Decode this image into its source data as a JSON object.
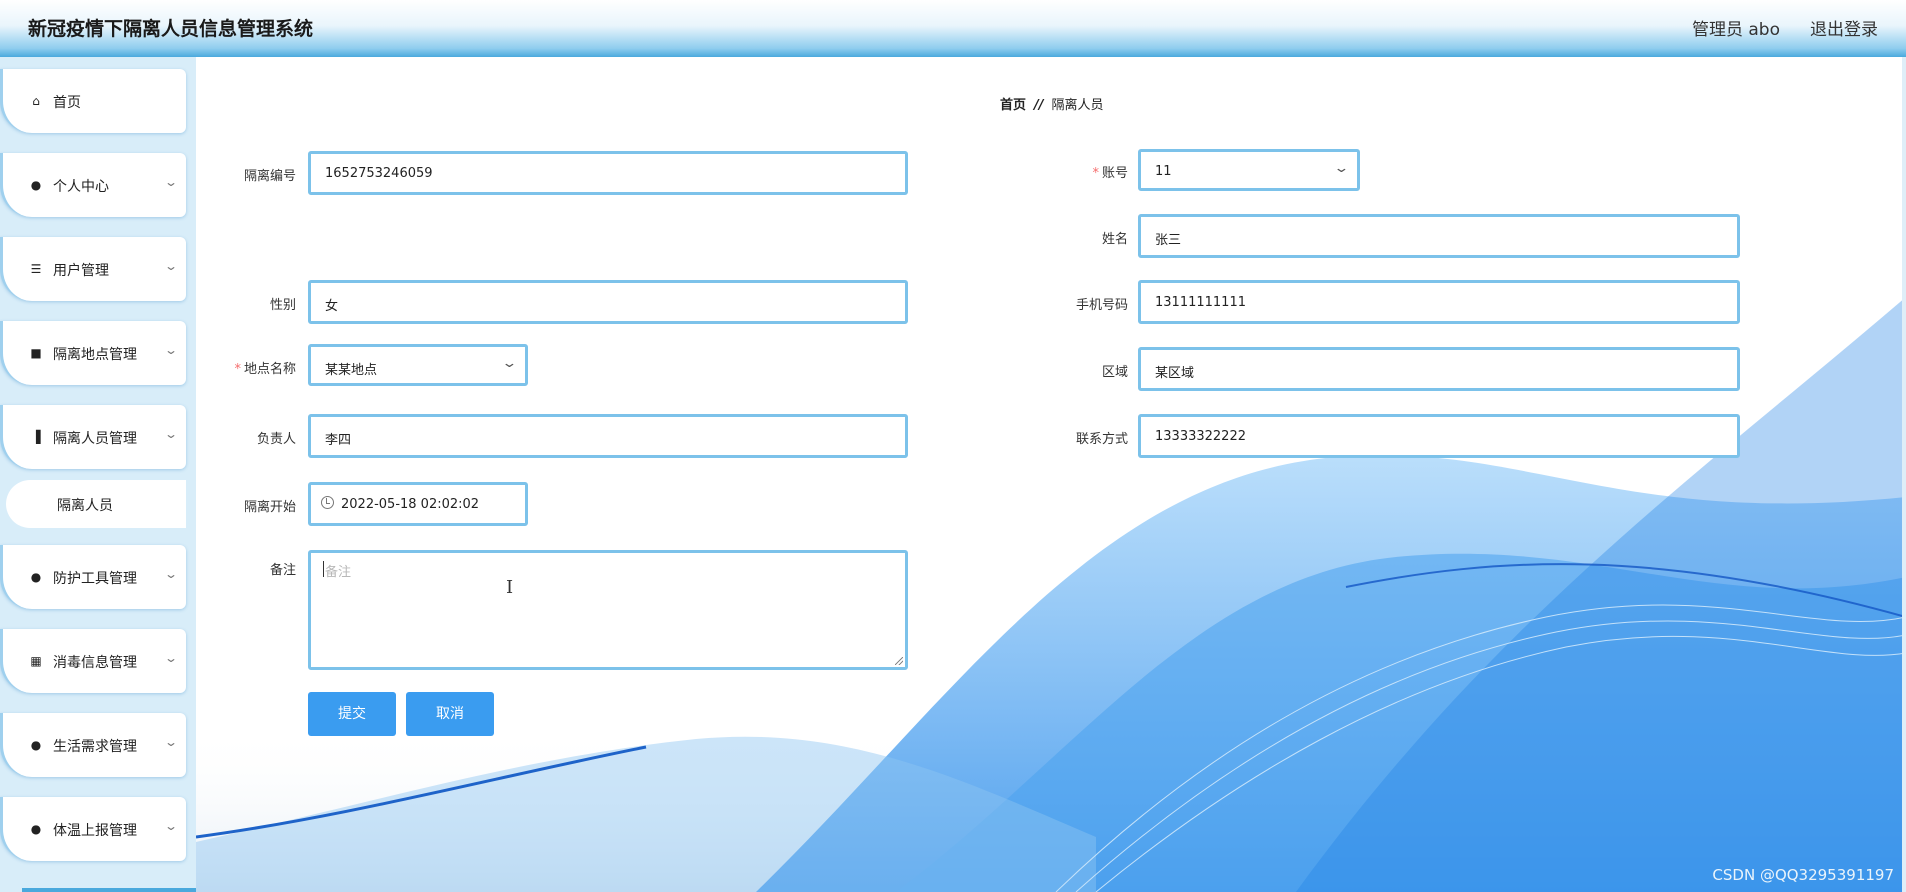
{
  "header": {
    "title": "新冠疫情下隔离人员信息管理系统",
    "user": "管理员 abo",
    "logout": "退出登录"
  },
  "sidebar": {
    "items": [
      {
        "label": "首页",
        "icon": "home-icon"
      },
      {
        "label": "个人中心",
        "icon": "person-icon"
      },
      {
        "label": "用户管理",
        "icon": "list-icon"
      },
      {
        "label": "隔离地点管理",
        "icon": "briefcase-icon"
      },
      {
        "label": "隔离人员管理",
        "icon": "building-icon"
      },
      {
        "label": "防护工具管理",
        "icon": "person-icon"
      },
      {
        "label": "消毒信息管理",
        "icon": "grid-icon"
      },
      {
        "label": "生活需求管理",
        "icon": "bulb-icon"
      },
      {
        "label": "体温上报管理",
        "icon": "person-icon"
      }
    ],
    "sub_item": "隔离人员"
  },
  "breadcrumb": {
    "home": "首页",
    "separator": "//",
    "current": "隔离人员"
  },
  "form": {
    "isolation_no": {
      "label": "隔离编号",
      "value": "1652753246059"
    },
    "account": {
      "label": "账号",
      "value": "11"
    },
    "name": {
      "label": "姓名",
      "value": "张三"
    },
    "gender": {
      "label": "性别",
      "value": "女"
    },
    "phone": {
      "label": "手机号码",
      "value": "13111111111"
    },
    "location": {
      "label": "地点名称",
      "value": "某某地点"
    },
    "region": {
      "label": "区域",
      "value": "某区域"
    },
    "manager": {
      "label": "负责人",
      "value": "李四"
    },
    "contact": {
      "label": "联系方式",
      "value": "13333322222"
    },
    "start": {
      "label": "隔离开始",
      "value": "2022-05-18 02:02:02"
    },
    "remark": {
      "label": "备注",
      "placeholder": "备注"
    },
    "submit": "提交",
    "cancel": "取消"
  },
  "watermark": "CSDN @QQ3295391197",
  "colors": {
    "accent": "#3a9cf0",
    "field_border": "#7cc2ea",
    "sidebar_bg": "#d8edf9",
    "required": "#f56c6c"
  }
}
